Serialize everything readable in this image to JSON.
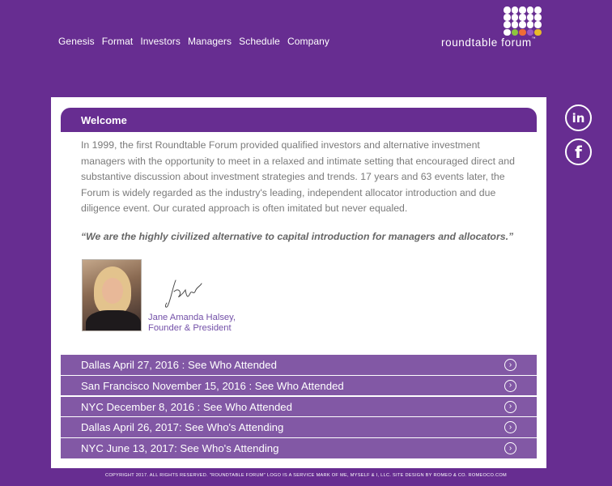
{
  "nav": {
    "items": [
      {
        "label": "Genesis"
      },
      {
        "label": "Format"
      },
      {
        "label": "Investors"
      },
      {
        "label": "Managers"
      },
      {
        "label": "Schedule"
      },
      {
        "label": "Company"
      }
    ]
  },
  "logo": {
    "text": "roundtable forum",
    "tm": "™",
    "dot_colors": [
      "#ffffff",
      "#8dc63f",
      "#ef6c35",
      "#9b59c4",
      "#e8bb2a"
    ]
  },
  "social": {
    "linkedin_glyph": "in",
    "facebook_glyph": "f"
  },
  "welcome": {
    "title": "Welcome",
    "intro": "In 1999, the first Roundtable Forum provided qualified investors and alternative investment managers with the opportunity to meet in a relaxed and intimate setting that encouraged direct and substantive discussion about investment strategies and trends.  17 years and 63 events later, the Forum is widely regarded as the industry's leading, independent allocator introduction and due diligence event. Our curated approach is often imitated but never equaled.",
    "quote": "“We are the highly civilized alternative to capital introduction for managers and allocators.”",
    "signer_name": "Jane Amanda Halsey,",
    "signer_title": "Founder & President"
  },
  "events": [
    {
      "label": "Dallas April 27, 2016 : See Who Attended"
    },
    {
      "label": "San Francisco November 15, 2016 : See Who Attended"
    },
    {
      "label": "NYC December 8, 2016 : See Who Attended"
    },
    {
      "label": "Dallas April 26, 2017: See Who's Attending"
    },
    {
      "label": "NYC June 13, 2017: See Who's Attending"
    }
  ],
  "footer": {
    "text": "COPYRIGHT 2017. ALL RIGHTS RESERVED. \"ROUNDTABLE FORUM\" LOGO IS A SERVICE MARK OF ME, MYSELF & I, LLC. SITE DESIGN BY ROMEO & CO. ROMEOCO.COM"
  },
  "colors": {
    "background": "#672d91",
    "event_bar": "#8258a5",
    "signature_text": "#7350a8"
  }
}
